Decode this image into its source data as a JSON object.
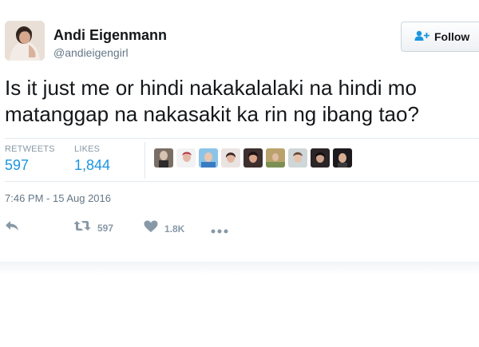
{
  "author": {
    "name": "Andi Eigenmann",
    "handle": "@andieigengirl"
  },
  "follow_button": {
    "label": "Follow"
  },
  "tweet": {
    "text_line1": "Is it just me or hindi nakakalalaki na hindi mo",
    "text_line2": "matanggap na nakasakit ka rin ng ibang tao?"
  },
  "stats": {
    "retweets_label": "RETWEETS",
    "retweets_value": "597",
    "likes_label": "LIKES",
    "likes_value": "1,844"
  },
  "likers": [
    {
      "icon": "avatar-1"
    },
    {
      "icon": "avatar-2"
    },
    {
      "icon": "avatar-3"
    },
    {
      "icon": "avatar-4"
    },
    {
      "icon": "avatar-5"
    },
    {
      "icon": "avatar-6"
    },
    {
      "icon": "avatar-7"
    },
    {
      "icon": "avatar-8"
    },
    {
      "icon": "avatar-9"
    }
  ],
  "timestamp": "7:46 PM - 15 Aug 2016",
  "actions": {
    "reply_icon": "reply-icon",
    "retweet_icon": "retweet-icon",
    "retweet_count": "597",
    "like_icon": "heart-icon",
    "like_count": "1.8K",
    "more_icon": "more-icon"
  },
  "colors": {
    "link_blue": "#1b95e0",
    "muted_gray": "#8899a6"
  }
}
